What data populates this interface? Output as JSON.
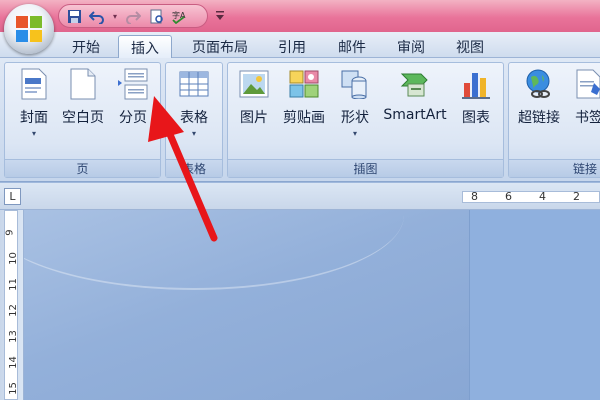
{
  "tabs": [
    {
      "label": "开始",
      "active": false
    },
    {
      "label": "插入",
      "active": true
    },
    {
      "label": "页面布局",
      "active": false
    },
    {
      "label": "引用",
      "active": false
    },
    {
      "label": "邮件",
      "active": false
    },
    {
      "label": "审阅",
      "active": false
    },
    {
      "label": "视图",
      "active": false
    }
  ],
  "ribbon": {
    "pages": {
      "label": "页",
      "buttons": [
        {
          "label": "封面",
          "icon": "cover-page-icon",
          "dropdown": "▾"
        },
        {
          "label": "空白页",
          "icon": "blank-page-icon"
        },
        {
          "label": "分页",
          "icon": "page-break-icon"
        }
      ]
    },
    "tables": {
      "label": "表格",
      "buttons": [
        {
          "label": "表格",
          "icon": "table-icon",
          "dropdown": "▾"
        }
      ]
    },
    "illustrations": {
      "label": "插图",
      "buttons": [
        {
          "label": "图片",
          "icon": "picture-icon"
        },
        {
          "label": "剪贴画",
          "icon": "clip-art-icon"
        },
        {
          "label": "形状",
          "icon": "shapes-icon",
          "dropdown": "▾"
        },
        {
          "label": "SmartArt",
          "icon": "smartart-icon"
        },
        {
          "label": "图表",
          "icon": "chart-icon"
        }
      ]
    },
    "links": {
      "label": "链接",
      "buttons": [
        {
          "label": "超链接",
          "icon": "hyperlink-icon"
        },
        {
          "label": "书签",
          "icon": "bookmark-icon"
        }
      ]
    }
  },
  "ruler": {
    "corner": "L",
    "top_numbers": [
      "8",
      "6",
      "4",
      "2"
    ],
    "left_numbers": [
      "9",
      "10",
      "11",
      "12",
      "13",
      "14",
      "15"
    ]
  },
  "colors": {
    "titlebar": "#e9739a",
    "arrow": "#e8161a",
    "ribbon": "#dce6f4",
    "document_background": "#93b0da"
  }
}
